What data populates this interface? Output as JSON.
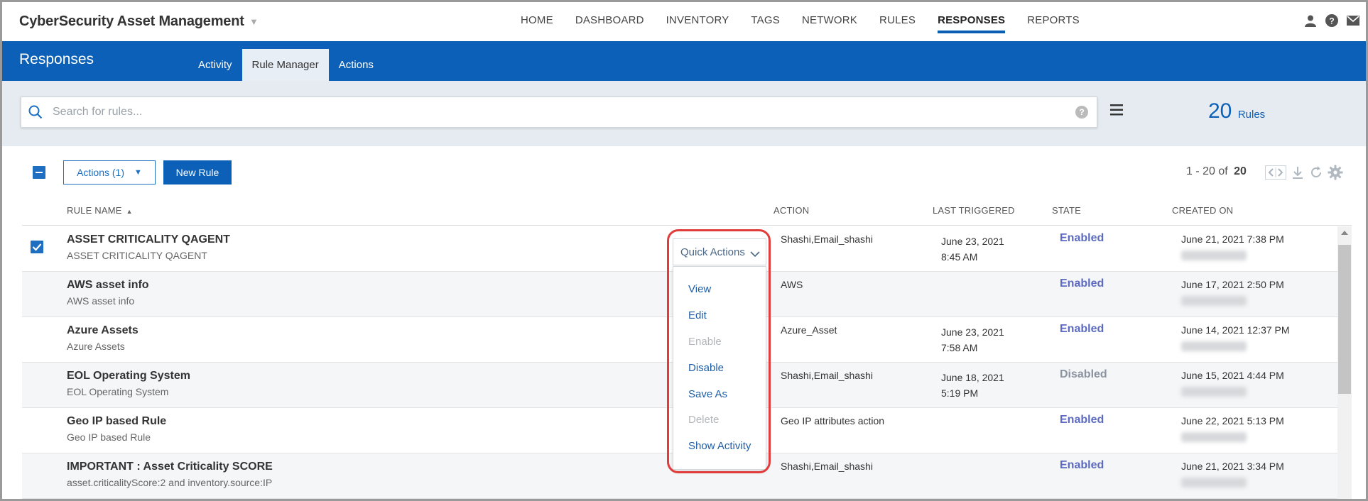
{
  "app": {
    "title": "CyberSecurity Asset Management"
  },
  "nav": [
    "HOME",
    "DASHBOARD",
    "INVENTORY",
    "TAGS",
    "NETWORK",
    "RULES",
    "RESPONSES",
    "REPORTS"
  ],
  "nav_active": "RESPONSES",
  "top_icons": [
    "user-icon",
    "help-icon",
    "mail-icon"
  ],
  "section": {
    "title": "Responses",
    "tabs": [
      {
        "label": "Activity",
        "active": false
      },
      {
        "label": "Rule Manager",
        "active": true
      },
      {
        "label": "Actions",
        "active": false
      }
    ]
  },
  "search": {
    "placeholder": "Search for rules...",
    "value": ""
  },
  "summary": {
    "count": "20",
    "label": "Rules"
  },
  "toolbar": {
    "actions_label": "Actions (1)",
    "new_rule_label": "New Rule",
    "pagination_range": "1 - 20 of",
    "pagination_total": "20"
  },
  "table": {
    "columns": {
      "name": "RULE NAME",
      "action": "ACTION",
      "last_triggered": "LAST TRIGGERED",
      "state": "STATE",
      "created_on": "CREATED ON"
    },
    "rows": [
      {
        "name": "ASSET CRITICALITY QAGENT",
        "description": "ASSET CRITICALITY QAGENT",
        "action": "Shashi,Email_shashi",
        "last_date": "June 23, 2021",
        "last_time": "8:45 AM",
        "state": "Enabled",
        "created": "June 21, 2021 7:38 PM",
        "selected": true
      },
      {
        "name": "AWS asset info",
        "description": "AWS asset info",
        "action": "AWS",
        "last_date": "",
        "last_time": "",
        "state": "Enabled",
        "created": "June 17, 2021 2:50 PM",
        "selected": false
      },
      {
        "name": "Azure Assets",
        "description": "Azure Assets",
        "action": "Azure_Asset",
        "last_date": "June 23, 2021",
        "last_time": "7:58 AM",
        "state": "Enabled",
        "created": "June 14, 2021 12:37 PM",
        "selected": false
      },
      {
        "name": "EOL Operating System",
        "description": "EOL Operating System",
        "action": "Shashi,Email_shashi",
        "last_date": "June 18, 2021",
        "last_time": "5:19 PM",
        "state": "Disabled",
        "created": "June 15, 2021 4:44 PM",
        "selected": false
      },
      {
        "name": "Geo IP based Rule",
        "description": "Geo IP based Rule",
        "action": "Geo IP attributes action",
        "last_date": "",
        "last_time": "",
        "state": "Enabled",
        "created": "June 22, 2021 5:13 PM",
        "selected": false
      },
      {
        "name": "IMPORTANT : Asset Criticality SCORE",
        "description": "asset.criticalityScore:2 and inventory.source:IP",
        "action": "Shashi,Email_shashi",
        "last_date": "",
        "last_time": "",
        "state": "Enabled",
        "created": "June 21, 2021 3:34 PM",
        "selected": false
      }
    ]
  },
  "quick_actions": {
    "label": "Quick Actions",
    "items": [
      {
        "label": "View",
        "enabled": true
      },
      {
        "label": "Edit",
        "enabled": true
      },
      {
        "label": "Enable",
        "enabled": false
      },
      {
        "label": "Disable",
        "enabled": true
      },
      {
        "label": "Save As",
        "enabled": true
      },
      {
        "label": "Delete",
        "enabled": false
      },
      {
        "label": "Show Activity",
        "enabled": true
      }
    ]
  },
  "colors": {
    "brand_blue": "#0d60b7",
    "enabled_state": "#5c6bc0",
    "disabled_state": "#8a93a0",
    "highlight_outline": "#e03c3c"
  }
}
